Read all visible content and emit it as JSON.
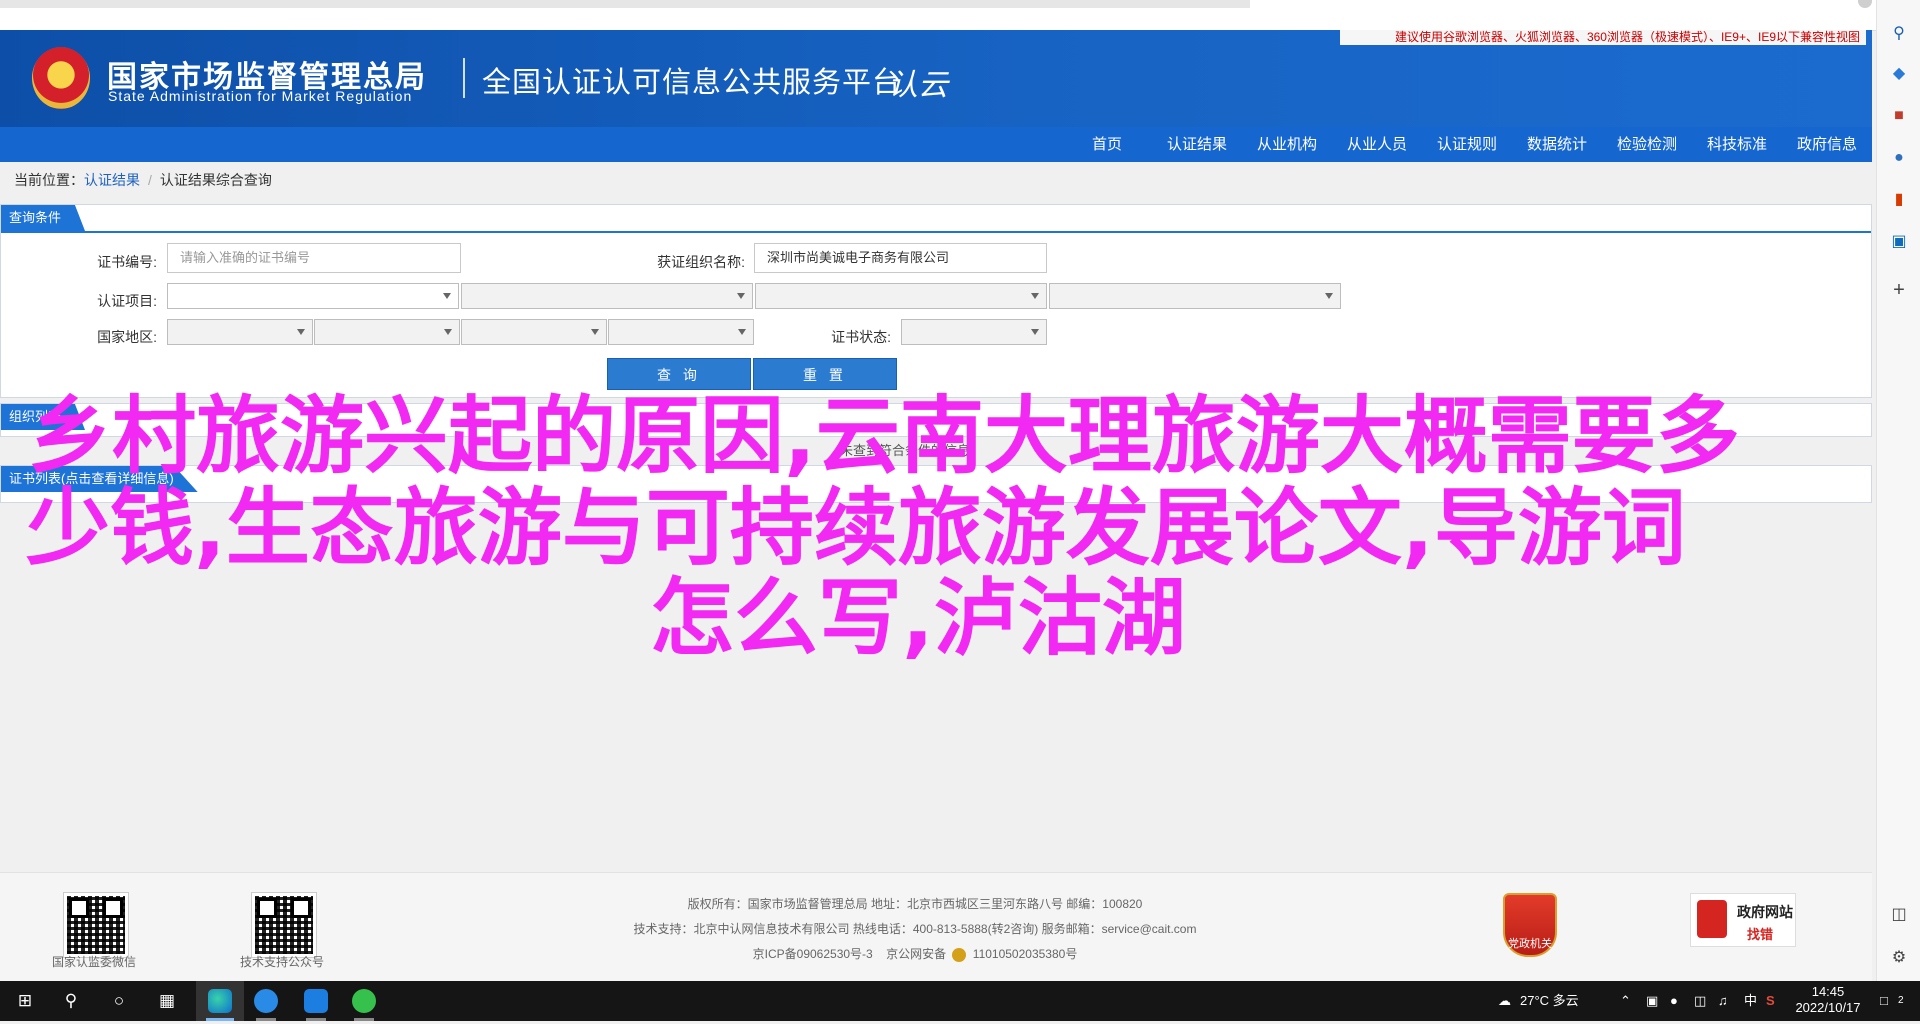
{
  "header": {
    "notice": "建议使用谷歌浏览器、火狐浏览器、360浏览器（极速模式）、IE9+、IE9以下兼容性视图",
    "agency_cn": "国家市场监督管理总局",
    "agency_en": "State Administration  for  Market Regulation",
    "platform_title": "全国认证认可信息公共服务平台",
    "platform_logo": "认云"
  },
  "nav": {
    "items": [
      {
        "label": "首页"
      },
      {
        "label": "认证结果"
      },
      {
        "label": "从业机构"
      },
      {
        "label": "从业人员"
      },
      {
        "label": "认证规则"
      },
      {
        "label": "数据统计"
      },
      {
        "label": "检验检测"
      },
      {
        "label": "科技标准"
      },
      {
        "label": "政府信息"
      }
    ]
  },
  "breadcrumb": {
    "prefix": "当前位置：",
    "link": "认证结果",
    "separator": "/",
    "current": "认证结果综合查询"
  },
  "query": {
    "tab": "查询条件",
    "cert_no_label": "证书编号:",
    "cert_no_placeholder": "请输入准确的证书编号",
    "org_label": "获证组织名称:",
    "org_value": "深圳市尚美诚电子商务有限公司",
    "project_label": "认证项目:",
    "region_label": "国家地区:",
    "status_label": "证书状态:",
    "search_button": "查 询",
    "reset_button": "重 置"
  },
  "panel2": {
    "tab": "组织列表"
  },
  "panel3": {
    "tab": "证书列表(点击查看详细信息)",
    "info": "未查到符合条件的信息"
  },
  "overlay": {
    "line1": "乡村旅游兴起的原因,云南大理旅游大概需要多",
    "line2": "少钱,生态旅游与可持续旅游发展论文,导游词",
    "line3": "怎么写,泸沽湖",
    "color": "#f129f2"
  },
  "footer": {
    "qr1_caption": "国家认监委微信",
    "qr2_caption": "技术支持公众号",
    "line1": "版权所有：国家市场监督管理总局    地址：北京市西城区三里河东路八号    邮编：100820",
    "line2": "技术支持：北京中认网信息技术有限公司    热线电话：400-813-5888(转2咨询)    服务邮箱：service@cait.com",
    "line3_icp": "京ICP备09062530号-3",
    "line3_police": "京公网安备",
    "line3_police_no": "11010502035380号",
    "party_badge": "党政机关",
    "gov_error_title": "政府网站",
    "gov_error_sub": "找错"
  },
  "sidebar": {
    "icons": [
      "search-icon",
      "tag-icon",
      "toolbox-icon",
      "people-icon",
      "office-icon",
      "outlook-icon",
      "add-icon",
      "panel-icon",
      "settings-icon"
    ]
  },
  "taskbar": {
    "weather": "27°C 多云",
    "ime": "中",
    "time": "14:45",
    "date": "2022/10/17",
    "notification_count": "2"
  }
}
